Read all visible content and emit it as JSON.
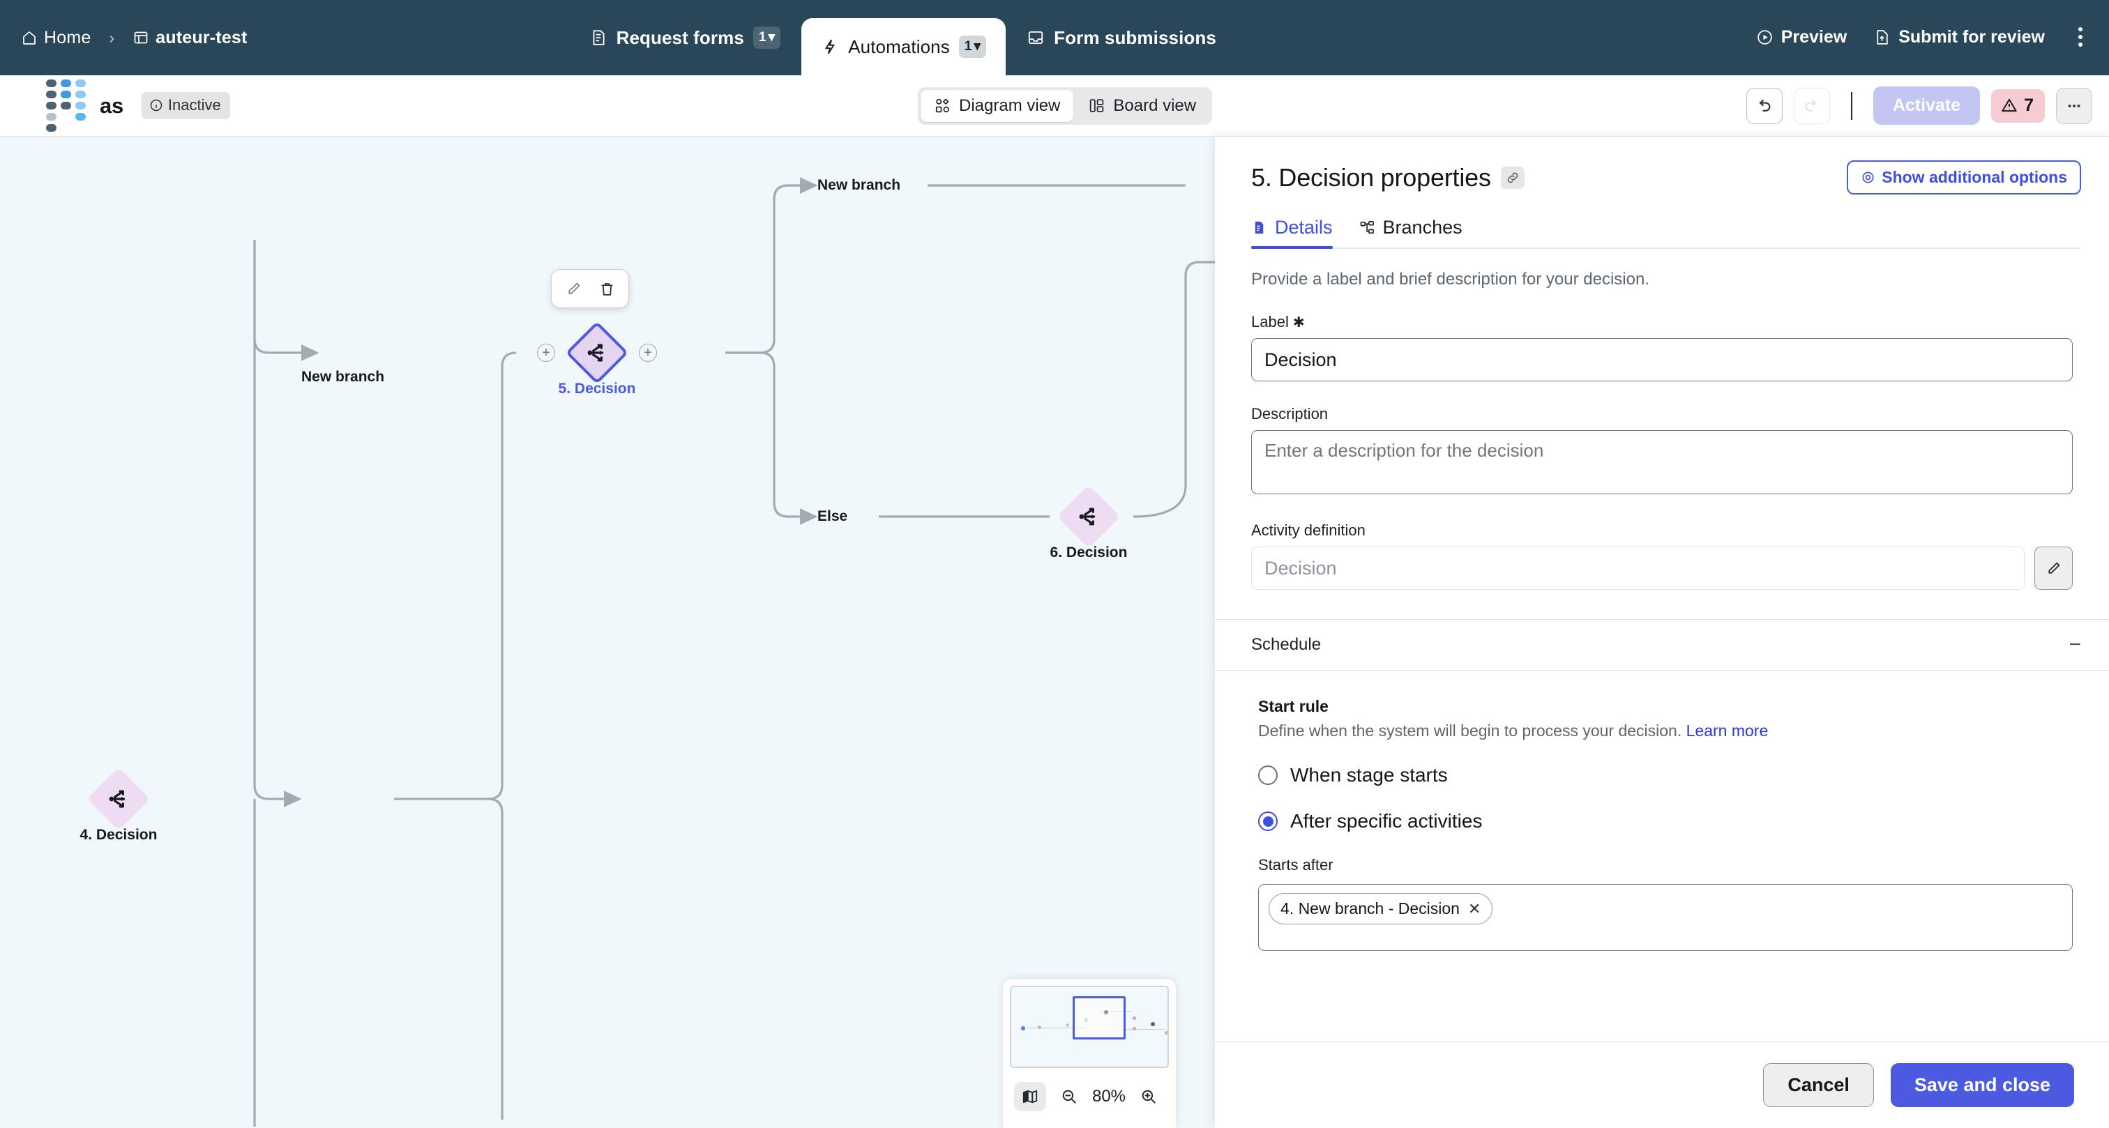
{
  "topnav": {
    "breadcrumb": [
      {
        "label": "Home",
        "icon": "home-icon"
      },
      {
        "label": "auteur-test",
        "icon": "board-icon"
      }
    ],
    "separator": "›",
    "tabs": [
      {
        "label": "Request forms",
        "count": "1",
        "icon": "form-icon",
        "active": false
      },
      {
        "label": "Automations",
        "count": "1",
        "icon": "automation-icon",
        "active": true
      },
      {
        "label": "Form submissions",
        "count": "",
        "icon": "inbox-icon",
        "active": false
      }
    ],
    "actions": [
      {
        "label": "Preview",
        "icon": "play-circle-icon"
      },
      {
        "label": "Submit for review",
        "icon": "upload-file-icon"
      }
    ],
    "overflow_icon": "kebab-menu-icon"
  },
  "subbar": {
    "brand": "as",
    "status": "Inactive",
    "status_icon": "info-icon",
    "views": [
      {
        "label": "Diagram view",
        "icon": "diagram-icon",
        "active": true
      },
      {
        "label": "Board view",
        "icon": "board-view-icon",
        "active": false
      }
    ],
    "undo_icon": "undo-icon",
    "redo_icon": "redo-icon",
    "activate_label": "Activate",
    "warning_count": "7",
    "warning_icon": "warning-triangle-icon",
    "more_icon": "ellipsis-icon"
  },
  "canvas": {
    "nodes": [
      {
        "id": "n4",
        "label": "4. Decision",
        "selected": false,
        "glyph": "decision-split-icon"
      },
      {
        "id": "n5",
        "label": "5. Decision",
        "selected": true,
        "glyph": "decision-split-icon"
      },
      {
        "id": "n6",
        "label": "6. Decision",
        "selected": false,
        "glyph": "decision-split-icon"
      }
    ],
    "edge_labels": [
      {
        "id": "e1",
        "text": "New branch"
      },
      {
        "id": "e2",
        "text": "New branch"
      },
      {
        "id": "e3",
        "text": "Else"
      }
    ],
    "node_toolbar": {
      "edit_icon": "pencil-icon",
      "delete_icon": "trash-icon"
    },
    "handles": {
      "plus": "+"
    },
    "minimap": {
      "toggle_icon": "map-icon",
      "zoom_out_icon": "zoom-out-icon",
      "zoom_in_icon": "zoom-in-icon",
      "zoom_level": "80%"
    },
    "accent_selected": "#4b5ae0",
    "node_fill": "#eedcf5",
    "background": "#f0f8fb"
  },
  "panel": {
    "title": "5. Decision properties",
    "link_icon": "link-icon",
    "additional_options": {
      "label": "Show additional options",
      "icon": "eye-icon"
    },
    "tabs": [
      {
        "label": "Details",
        "icon": "details-doc-icon",
        "active": true
      },
      {
        "label": "Branches",
        "icon": "branches-icon",
        "active": false
      }
    ],
    "hint": "Provide a label and brief description for your decision.",
    "fields": {
      "label": {
        "label": "Label",
        "required_mark": "✱",
        "value": "Decision"
      },
      "description": {
        "label": "Description",
        "placeholder": "Enter a description for the decision",
        "value": ""
      },
      "activity_definition": {
        "label": "Activity definition",
        "placeholder": "Decision",
        "value": "",
        "edit_icon": "pencil-icon"
      }
    },
    "schedule": {
      "title": "Schedule",
      "collapse_icon": "−",
      "start_rule": {
        "title": "Start rule",
        "description": "Define when the system will begin to process your decision.",
        "link_label": "Learn more",
        "options": [
          {
            "label": "When stage starts",
            "selected": false
          },
          {
            "label": "After specific activities",
            "selected": true
          }
        ]
      },
      "starts_after": {
        "label": "Starts after",
        "chips": [
          {
            "text": "4. New branch - Decision",
            "remove_icon": "✕"
          }
        ]
      }
    },
    "footer": {
      "cancel": "Cancel",
      "save": "Save and close"
    }
  }
}
